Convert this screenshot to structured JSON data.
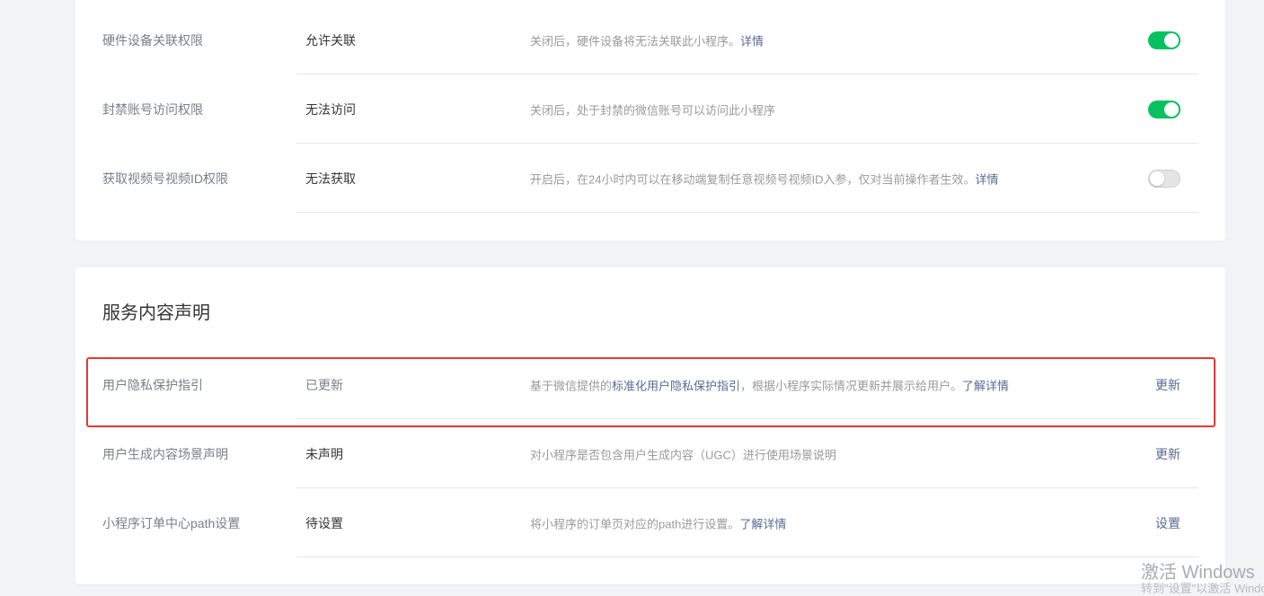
{
  "permissions": [
    {
      "label": "硬件设备关联权限",
      "value": "允许关联",
      "desc": "关闭后，硬件设备将无法关联此小程序。",
      "link": "详情",
      "toggle": "on"
    },
    {
      "label": "封禁账号访问权限",
      "value": "无法访问",
      "desc": "关闭后，处于封禁的微信账号可以访问此小程序",
      "link": "",
      "toggle": "on"
    },
    {
      "label": "获取视频号视频ID权限",
      "value": "无法获取",
      "desc": "开启后，在24小时内可以在移动端复制任意视频号视频ID入参，仅对当前操作者生效。",
      "link": "详情",
      "toggle": "off"
    }
  ],
  "service": {
    "title": "服务内容声明",
    "rows": [
      {
        "label": "用户隐私保护指引",
        "value": "已更新",
        "desc_pre": "基于微信提供的",
        "desc_link": "标准化用户隐私保护指引",
        "desc_post": "，根据小程序实际情况更新并展示给用户。",
        "desc_link2": "了解详情",
        "action": "更新"
      },
      {
        "label": "用户生成内容场景声明",
        "value": "未声明",
        "desc_pre": "对小程序是否包含用户生成内容（UGC）进行使用场景说明",
        "desc_link": "",
        "desc_post": "",
        "desc_link2": "",
        "action": "更新"
      },
      {
        "label": "小程序订单中心path设置",
        "value": "待设置",
        "desc_pre": "将小程序的订单页对应的path进行设置。",
        "desc_link": "",
        "desc_post": "",
        "desc_link2": "了解详情",
        "action": "设置"
      }
    ]
  },
  "watermark": {
    "line1": "激活 Windows",
    "line2": "转到\"设置\"以激活 Windows。"
  },
  "colors": {
    "toggle_on": "#07c160",
    "link": "#576b95",
    "highlight": "#e53935"
  }
}
